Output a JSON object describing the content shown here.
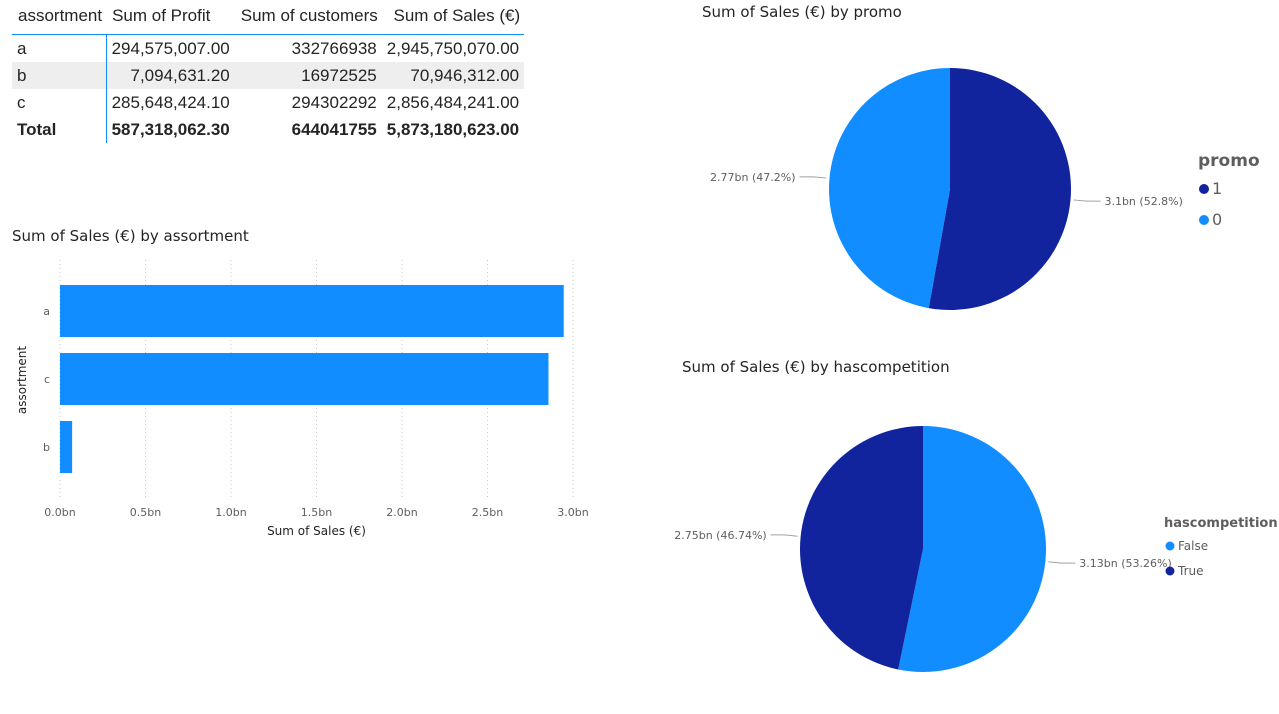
{
  "table": {
    "columns": [
      "assortment",
      "Sum of Profit",
      "Sum of customers",
      "Sum of Sales (€)"
    ],
    "rows": [
      {
        "label": "a",
        "profit": "294,575,007.00",
        "customers": "332766938",
        "sales": "2,945,750,070.00"
      },
      {
        "label": "b",
        "profit": "7,094,631.20",
        "customers": "16972525",
        "sales": "70,946,312.00"
      },
      {
        "label": "c",
        "profit": "285,648,424.10",
        "customers": "294302292",
        "sales": "2,856,484,241.00"
      }
    ],
    "total": {
      "label": "Total",
      "profit": "587,318,062.30",
      "customers": "644041755",
      "sales": "5,873,180,623.00"
    }
  },
  "colors": {
    "dark": "#12239e",
    "light": "#118dff",
    "grid": "#c8c8c8",
    "text": "#252423",
    "muted": "#605e5c"
  },
  "chart_data": [
    {
      "type": "bar",
      "orientation": "horizontal",
      "title": "Sum of Sales (€) by assortment",
      "xlabel": "Sum of Sales (€)",
      "ylabel": "assortment",
      "categories": [
        "a",
        "c",
        "b"
      ],
      "values": [
        2945750070,
        2856484241,
        70946312
      ],
      "xlim": [
        0,
        3000000000
      ],
      "xticks": [
        "0.0bn",
        "0.5bn",
        "1.0bn",
        "1.5bn",
        "2.0bn",
        "2.5bn",
        "3.0bn"
      ],
      "grid": true,
      "color": "#118dff"
    },
    {
      "type": "pie",
      "title": "Sum of Sales (€) by promo",
      "legend_title": "promo",
      "legend_position": "right",
      "slices": [
        {
          "name": "1",
          "value": 3.1,
          "label": "3.1bn (52.8%)",
          "color": "#12239e"
        },
        {
          "name": "0",
          "value": 2.77,
          "label": "2.77bn (47.2%)",
          "color": "#118dff"
        }
      ]
    },
    {
      "type": "pie",
      "title": "Sum of Sales (€) by hascompetition",
      "legend_title": "hascompetition",
      "legend_position": "right",
      "slices": [
        {
          "name": "False",
          "value": 3.13,
          "label": "3.13bn (53.26%)",
          "color": "#118dff"
        },
        {
          "name": "True",
          "value": 2.75,
          "label": "2.75bn (46.74%)",
          "color": "#12239e"
        }
      ]
    }
  ]
}
